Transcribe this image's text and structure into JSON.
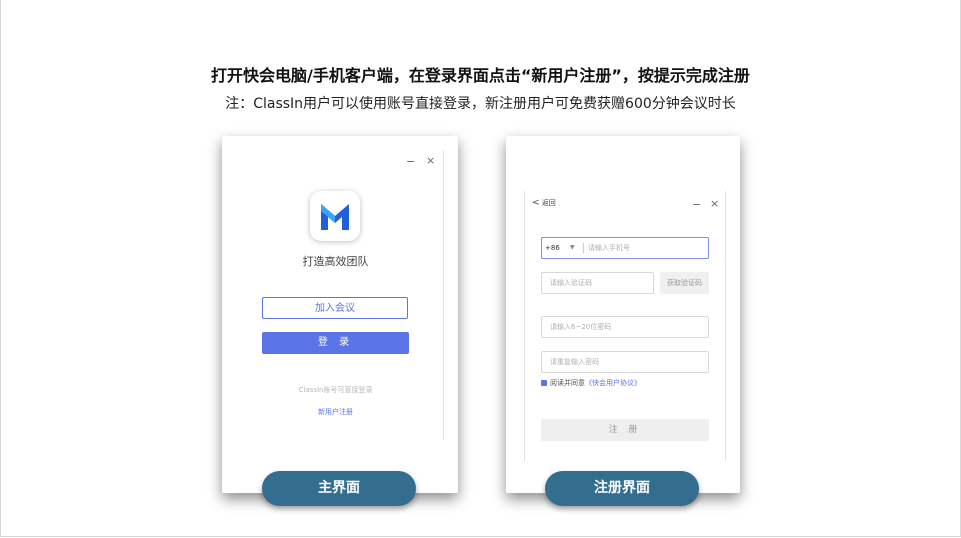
{
  "headline": "打开快会电脑/手机客户端，在登录界面点击“新用户注册”，按提示完成注册",
  "subline": "注：ClassIn用户可以使用账号直接登录，新注册用户可免费获赠600分钟会议时长",
  "main_window": {
    "minimize": "−",
    "close": "×",
    "slogan": "打造高效团队",
    "join_label": "加入会议",
    "login_label": "登 录",
    "hint": "ClassIn账号可直接登录",
    "register_link": "新用户注册",
    "logo_icon": "m-logo-icon",
    "brand_blue": "#1f5fe0",
    "brand_light": "#3da3f5"
  },
  "register_window": {
    "back_arrow": "<",
    "back_label": "返回",
    "minimize": "−",
    "close": "×",
    "country_code": "+86",
    "country_caret": "▼",
    "phone_placeholder": "请输入手机号",
    "code_placeholder": "请输入验证码",
    "get_code_label": "获取验证码",
    "password_placeholder": "请输入6~20位密码",
    "confirm_placeholder": "请重复输入密码",
    "agree_text": "阅读并同意",
    "agreement_link": "《快会用户协议》",
    "submit_label": "注 册"
  },
  "captions": {
    "main": "主界面",
    "register": "注册界面"
  },
  "colors": {
    "accent": "#5b74e8",
    "caption_bg": "#336e8e"
  }
}
